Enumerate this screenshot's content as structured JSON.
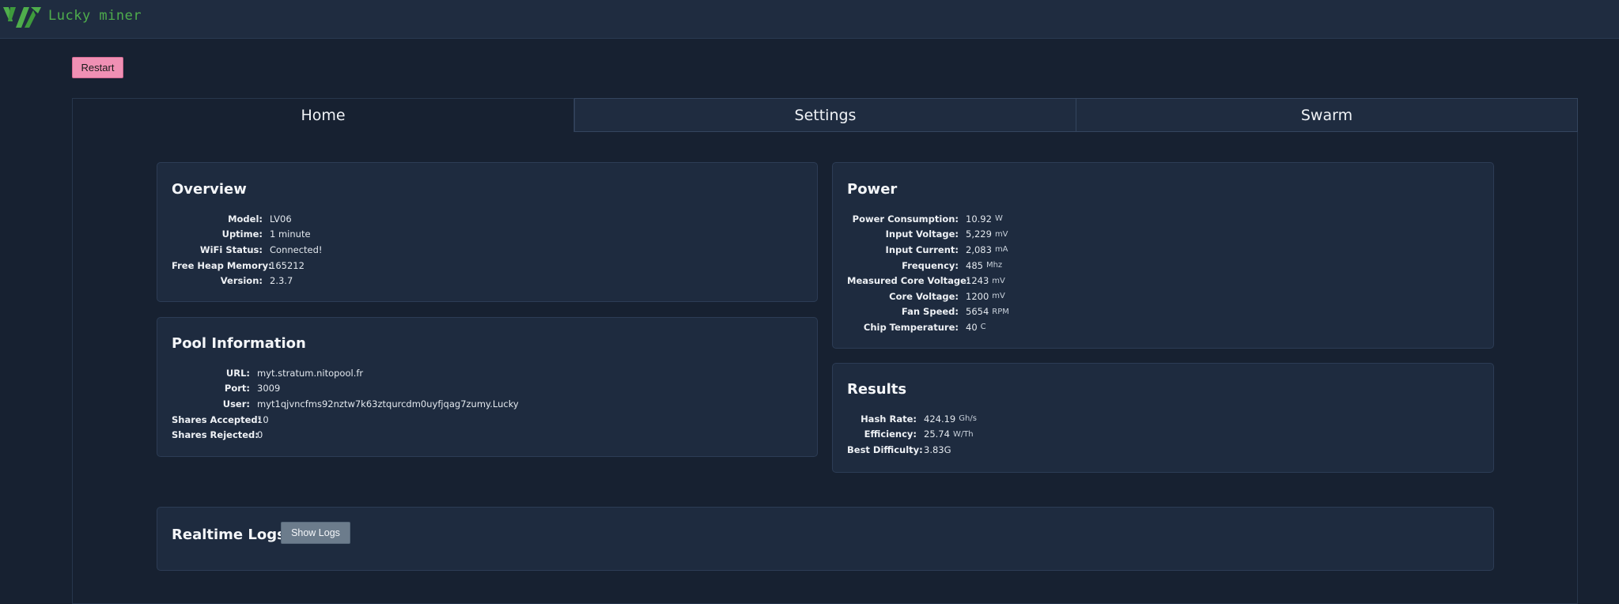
{
  "app": {
    "brand": "Lucky miner",
    "accent_color": "#4fae4c"
  },
  "actions": {
    "restart_label": "Restart",
    "show_logs_label": "Show Logs"
  },
  "tabs": [
    {
      "label": "Home",
      "active": true
    },
    {
      "label": "Settings",
      "active": false
    },
    {
      "label": "Swarm",
      "active": false
    }
  ],
  "overview": {
    "title": "Overview",
    "rows": [
      {
        "label": "Model:",
        "value": "LV06"
      },
      {
        "label": "Uptime:",
        "value": "1 minute"
      },
      {
        "label": "WiFi Status:",
        "value": "Connected!"
      },
      {
        "label": "Free Heap Memory:",
        "value": "165212"
      },
      {
        "label": "Version:",
        "value": "2.3.7"
      }
    ]
  },
  "pool": {
    "title": "Pool Information",
    "rows": [
      {
        "label": "URL:",
        "value": "myt.stratum.nitopool.fr"
      },
      {
        "label": "Port:",
        "value": "3009"
      },
      {
        "label": "User:",
        "value": "myt1qjvncfms92nztw7k63ztqurcdm0uyfjqag7zumy.Lucky"
      },
      {
        "label": "Shares Accepted:",
        "value": "10"
      },
      {
        "label": "Shares Rejected:",
        "value": "0"
      }
    ]
  },
  "power": {
    "title": "Power",
    "rows": [
      {
        "label": "Power Consumption:",
        "value": "10.92",
        "unit": "W"
      },
      {
        "label": "Input Voltage:",
        "value": "5,229",
        "unit": "mV"
      },
      {
        "label": "Input Current:",
        "value": "2,083",
        "unit": "mA"
      },
      {
        "label": "Frequency:",
        "value": "485",
        "unit": "Mhz"
      },
      {
        "label": "Measured Core Voltage:",
        "value": "1243",
        "unit": "mV"
      },
      {
        "label": "Core Voltage:",
        "value": "1200",
        "unit": "mV"
      },
      {
        "label": "Fan Speed:",
        "value": "5654",
        "unit": "RPM"
      },
      {
        "label": "Chip Temperature:",
        "value": "40",
        "unit": "C"
      }
    ]
  },
  "results": {
    "title": "Results",
    "rows": [
      {
        "label": "Hash Rate:",
        "value": "424.19",
        "unit": "Gh/s"
      },
      {
        "label": "Efficiency:",
        "value": "25.74",
        "unit": "W/Th"
      },
      {
        "label": "Best Difficulty:",
        "value": "3.83G"
      }
    ]
  },
  "logs": {
    "title": "Realtime Logs"
  }
}
